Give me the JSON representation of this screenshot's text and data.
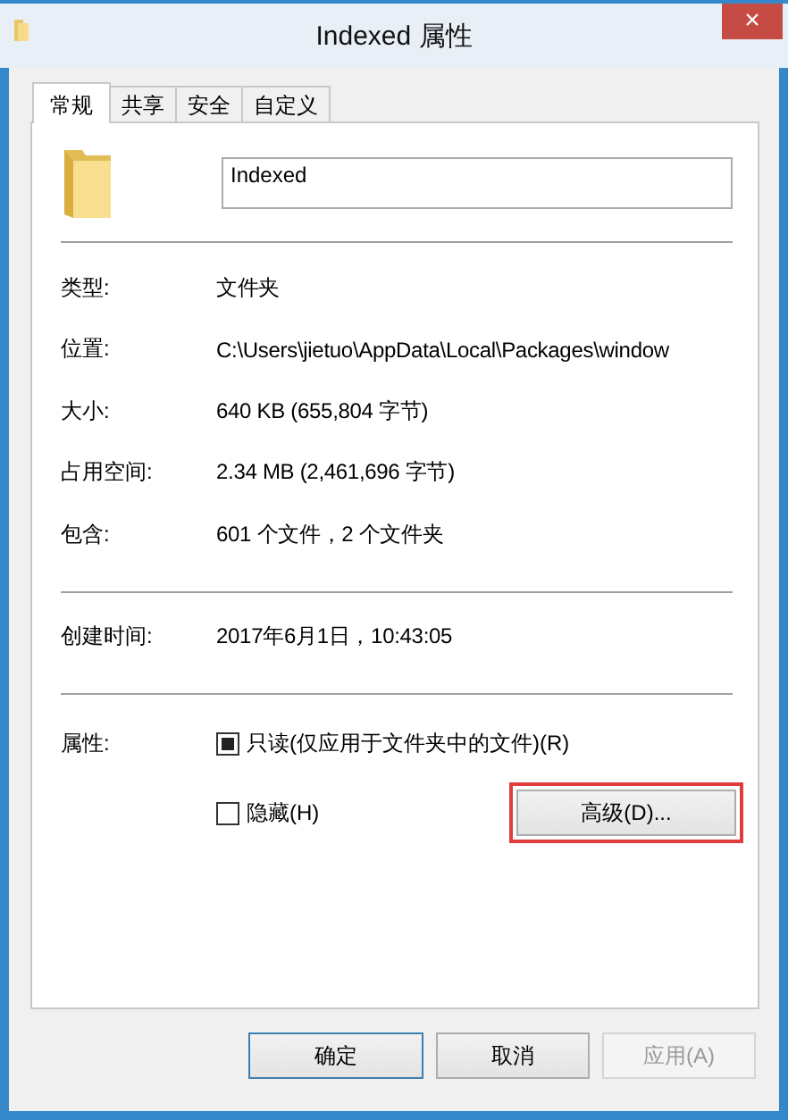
{
  "window": {
    "title": "Indexed 属性",
    "close": "×"
  },
  "tabs": [
    {
      "label": "常规",
      "selected": true
    },
    {
      "label": "共享",
      "selected": false
    },
    {
      "label": "安全",
      "selected": false
    },
    {
      "label": "自定义",
      "selected": false
    }
  ],
  "name_field": {
    "value": "Indexed"
  },
  "sections": [
    [
      {
        "label": "类型:",
        "value": "文件夹"
      },
      {
        "label": "位置:",
        "value": "C:\\Users\\jietuo\\AppData\\Local\\Packages\\window"
      },
      {
        "label": "大小:",
        "value": "640 KB (655,804 字节)"
      },
      {
        "label": "占用空间:",
        "value": "2.34 MB (2,461,696 字节)"
      },
      {
        "label": "包含:",
        "value": "601 个文件，2 个文件夹"
      }
    ],
    [
      {
        "label": "创建时间:",
        "value": "2017年6月1日，10:43:05"
      }
    ]
  ],
  "attributes": {
    "label": "属性:",
    "options": [
      {
        "label": "只读(仅应用于文件夹中的文件)(R)",
        "checked": false,
        "indeterminate": true
      },
      {
        "label": "隐藏(H)",
        "checked": false,
        "indeterminate": false
      }
    ],
    "advanced_button": {
      "label": "高级(D)...",
      "highlighted": true
    }
  },
  "buttons": [
    {
      "label": "确定",
      "default": true,
      "disabled": false
    },
    {
      "label": "取消",
      "default": false,
      "disabled": false
    },
    {
      "label": "应用(A)",
      "default": false,
      "disabled": true
    }
  ]
}
